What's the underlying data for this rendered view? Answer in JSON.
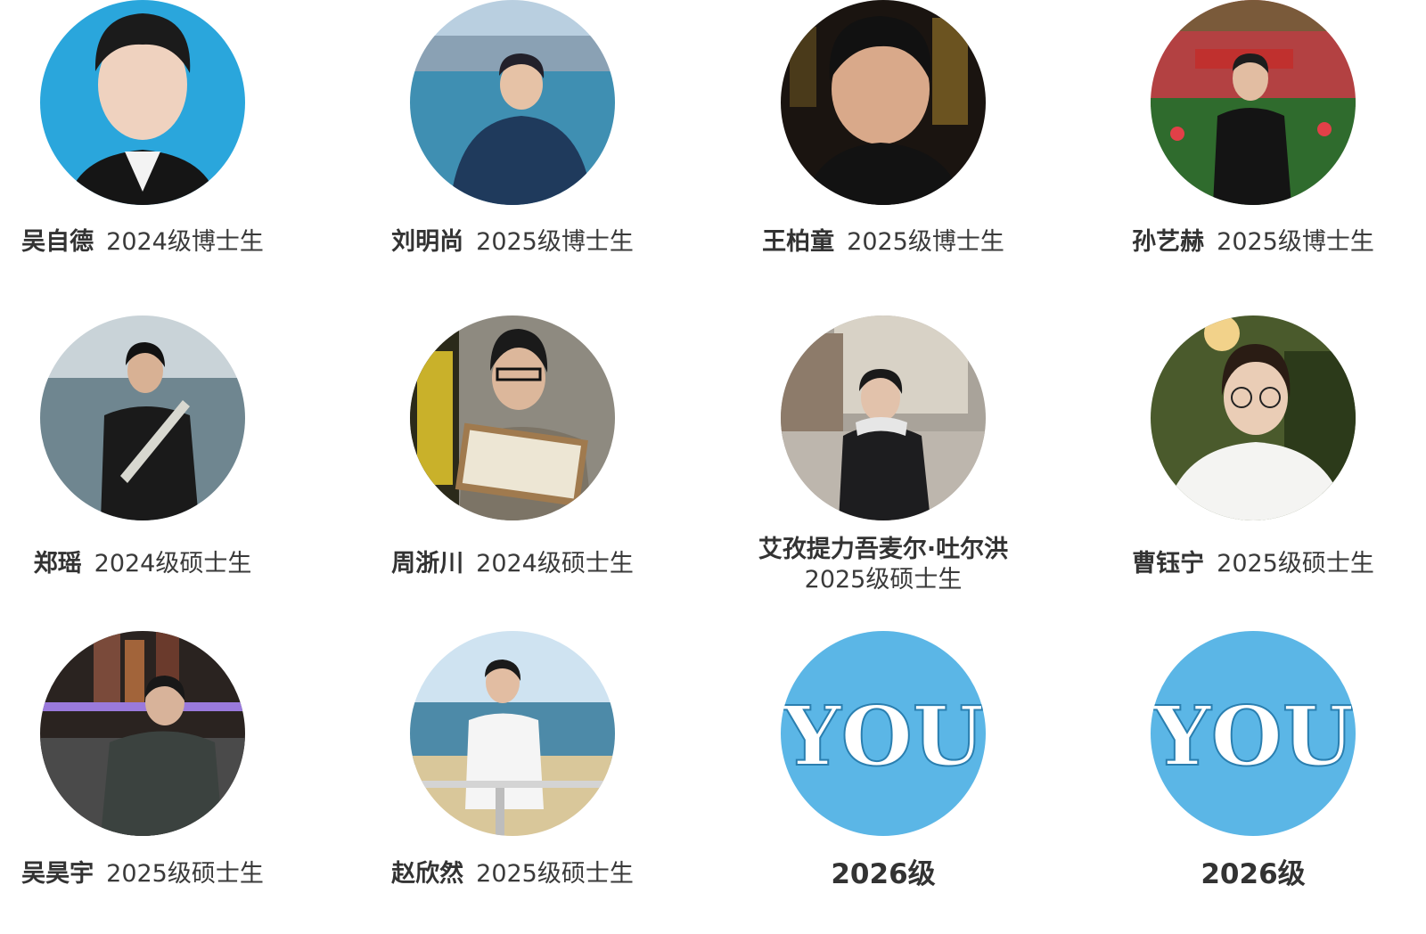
{
  "colors": {
    "you_disc": "#5bb6e6",
    "caption_text": "#333333",
    "page_bg": "#ffffff"
  },
  "members": [
    {
      "name": "吴自德",
      "grade": "2024级博士生",
      "photo_icon": "portrait-photo-blue-backdrop"
    },
    {
      "name": "刘明尚",
      "grade": "2025级博士生",
      "photo_icon": "portrait-photo-seaside"
    },
    {
      "name": "王柏童",
      "grade": "2025级博士生",
      "photo_icon": "portrait-photo-night"
    },
    {
      "name": "孙艺赫",
      "grade": "2025级博士生",
      "photo_icon": "portrait-photo-gate"
    },
    {
      "name": "郑瑶",
      "grade": "2024级硕士生",
      "photo_icon": "portrait-photo-coast"
    },
    {
      "name": "周浙川",
      "grade": "2024级硕士生",
      "photo_icon": "portrait-photo-indoor"
    },
    {
      "name": "艾孜提力吾麦尔·吐尔洪",
      "grade": "2025级硕士生",
      "photo_icon": "portrait-photo-street"
    },
    {
      "name": "曹钰宁",
      "grade": "2025级硕士生",
      "photo_icon": "portrait-photo-garden"
    },
    {
      "name": "吴昊宇",
      "grade": "2025级硕士生",
      "photo_icon": "portrait-photo-city-night"
    },
    {
      "name": "赵欣然",
      "grade": "2025级硕士生",
      "photo_icon": "portrait-photo-beach"
    }
  ],
  "placeholders": [
    {
      "text": "YOU",
      "grade": "2026级"
    },
    {
      "text": "YOU",
      "grade": "2026级"
    }
  ]
}
